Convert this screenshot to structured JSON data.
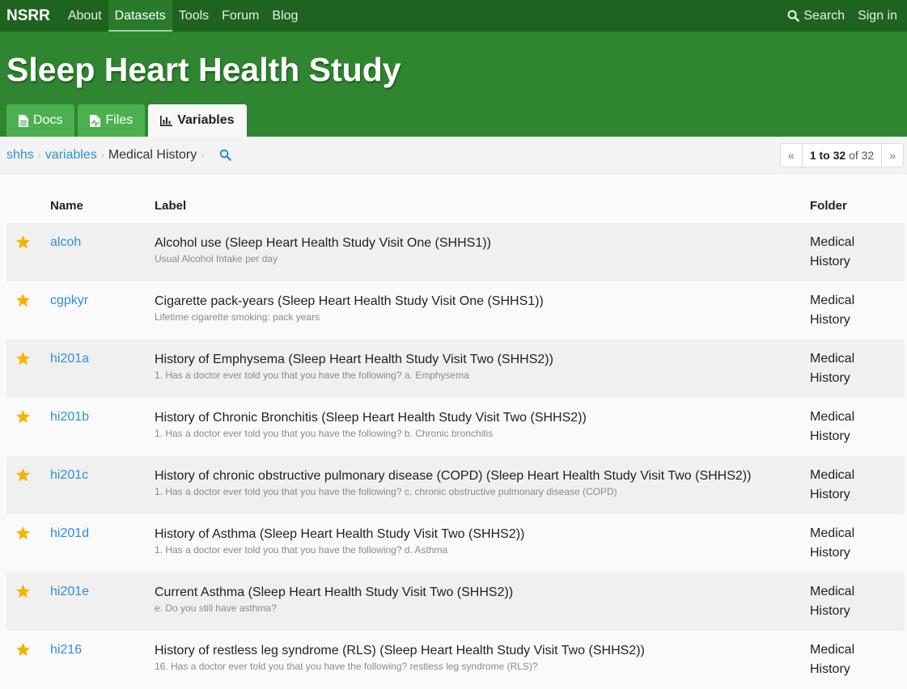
{
  "nav": {
    "brand": "NSRR",
    "links": [
      "About",
      "Datasets",
      "Tools",
      "Forum",
      "Blog"
    ],
    "search": "Search",
    "signin": "Sign in"
  },
  "header": {
    "title": "Sleep Heart Health Study",
    "tabs": [
      "Docs",
      "Files",
      "Variables"
    ]
  },
  "breadcrumb": {
    "dataset": "shhs",
    "section": "variables",
    "current": "Medical History"
  },
  "pager": {
    "prev": "«",
    "range": "1 to 32",
    "of": "of 32",
    "next": "»"
  },
  "table": {
    "headers": {
      "name": "Name",
      "label": "Label",
      "folder": "Folder"
    },
    "rows": [
      {
        "name": "alcoh",
        "label": "Alcohol use (Sleep Heart Health Study Visit One (SHHS1))",
        "desc": "Usual Alcohol Intake per day",
        "folder1": "Medical",
        "folder2": "History"
      },
      {
        "name": "cgpkyr",
        "label": "Cigarette pack-years (Sleep Heart Health Study Visit One (SHHS1))",
        "desc": "Lifetime cigarette smoking: pack years",
        "folder1": "Medical",
        "folder2": "History"
      },
      {
        "name": "hi201a",
        "label": "History of Emphysema (Sleep Heart Health Study Visit Two (SHHS2))",
        "desc": "1. Has a doctor ever told you that you have the following? a. Emphysema",
        "folder1": "Medical",
        "folder2": "History"
      },
      {
        "name": "hi201b",
        "label": "History of Chronic Bronchitis (Sleep Heart Health Study Visit Two (SHHS2))",
        "desc": "1. Has a doctor ever told you that you have the following? b. Chronic bronchitis",
        "folder1": "Medical",
        "folder2": "History"
      },
      {
        "name": "hi201c",
        "label": "History of chronic obstructive pulmonary disease (COPD) (Sleep Heart Health Study Visit Two (SHHS2))",
        "desc": "1. Has a doctor ever told you that you have the following? c. chronic obstructive pulmonary disease (COPD)",
        "folder1": "Medical",
        "folder2": "History"
      },
      {
        "name": "hi201d",
        "label": "History of Asthma (Sleep Heart Health Study Visit Two (SHHS2))",
        "desc": "1. Has a doctor ever told you that you have the following? d. Asthma",
        "folder1": "Medical",
        "folder2": "History"
      },
      {
        "name": "hi201e",
        "label": "Current Asthma (Sleep Heart Health Study Visit Two (SHHS2))",
        "desc": "e. Do you still have asthma?",
        "folder1": "Medical",
        "folder2": "History"
      },
      {
        "name": "hi216",
        "label": "History of restless leg syndrome (RLS) (Sleep Heart Health Study Visit Two (SHHS2))",
        "desc": "16. Has a doctor ever told you that you have the following? restless leg syndrome (RLS)?",
        "folder1": "Medical",
        "folder2": "History"
      }
    ]
  },
  "icons": {
    "star": "star-icon",
    "search": "search-icon",
    "docs": "document-icon",
    "files": "file-icon",
    "variables": "bar-chart-icon"
  },
  "colors": {
    "navbar": "#1e6420",
    "header": "#2f8530",
    "tab": "#4caf50",
    "link": "#2f8fd8",
    "star": "#f5b301"
  }
}
